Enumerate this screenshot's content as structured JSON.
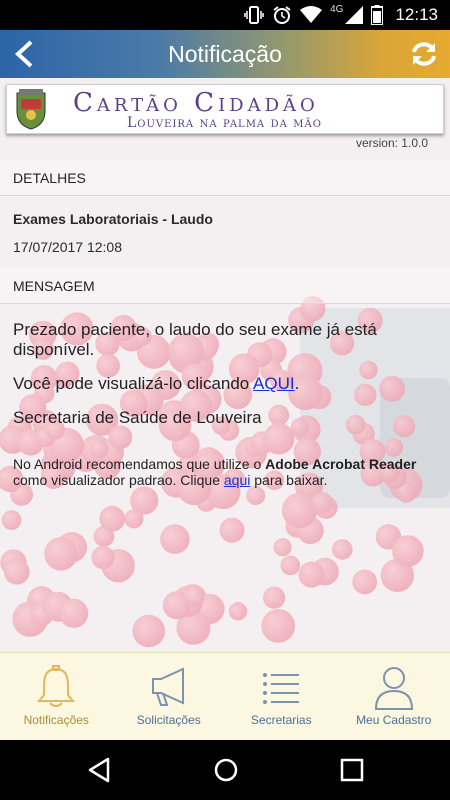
{
  "status_bar": {
    "time": "12:13",
    "network": "4G",
    "icons": [
      "vibrate-icon",
      "alarm-icon",
      "wifi-icon",
      "signal-icon",
      "battery-icon"
    ]
  },
  "app_bar": {
    "title": "Notificação",
    "back_icon": "chevron-left-icon",
    "refresh_icon": "refresh-icon",
    "gradient_colors": [
      "#2b65a8",
      "#e7a92e"
    ]
  },
  "banner": {
    "title": "Cartão Cidadão",
    "subtitle": "Louveira na palma da mão",
    "brand_color": "#5b3f8c"
  },
  "version": "version: 1.0.0",
  "details": {
    "header": "DETALHES",
    "title": "Exames Laboratoriais - Laudo",
    "datetime": "17/07/2017 12:08"
  },
  "message": {
    "header": "MENSAGEM",
    "line1": "Prezado paciente, o laudo do seu exame já está disponível.",
    "line2_prefix": "Você pode visualizá-lo clicando ",
    "line2_link": "AQUI",
    "line2_suffix": ".",
    "line3": "Secretaria de Saúde de Louveira",
    "note_prefix": "No Android recomendamos que utilize o ",
    "note_bold": "Adobe Acrobat Reader",
    "note_middle": " como visualizador padrao. Clique ",
    "note_link": "aqui",
    "note_suffix": " para baixar.",
    "link_color": "#1a2fd6"
  },
  "bottom_nav": {
    "items": [
      {
        "label": "Notificações",
        "icon": "bell-icon",
        "active": true
      },
      {
        "label": "Solicitações",
        "icon": "megaphone-icon",
        "active": false
      },
      {
        "label": "Secretarias",
        "icon": "list-icon",
        "active": false
      },
      {
        "label": "Meu Cadastro",
        "icon": "user-icon",
        "active": false
      }
    ],
    "active_color": "#b08a3c",
    "inactive_color": "#4d6f99"
  },
  "system_nav": {
    "icons": [
      "back-triangle-icon",
      "home-circle-icon",
      "recents-square-icon"
    ]
  }
}
